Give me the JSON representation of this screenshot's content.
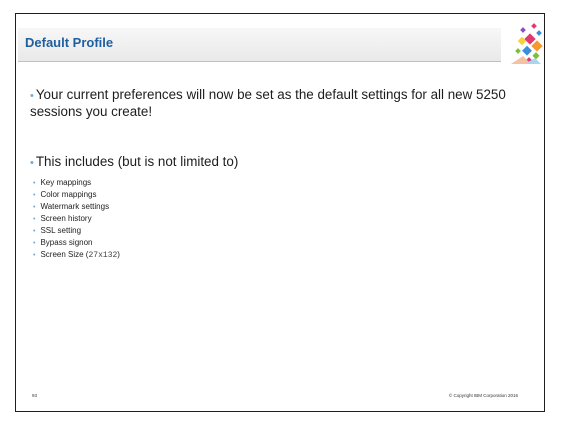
{
  "slide": {
    "title": "Default Profile",
    "bullets": [
      {
        "text": "Your current preferences will now be set as the default settings for all new 5250 sessions you create!"
      },
      {
        "text": "This includes (but is not limited to)"
      }
    ],
    "sub_items": [
      "Key mappings",
      "Color mappings",
      "Watermark settings",
      "Screen history",
      "SSL setting",
      "Bypass signon"
    ],
    "last_sub_item": {
      "text": "Screen Size (",
      "code": "27x132",
      "tail": ")"
    },
    "page_number": "93",
    "copyright": "© Copyright IBM Corporation 2016"
  },
  "colors": {
    "title": "#1f5fa0",
    "bullet": "#6aaed6",
    "logo": [
      "#e23a6e",
      "#f29a2e",
      "#7bbf3a",
      "#3a8fd8",
      "#8a4fc0",
      "#f3d23a"
    ]
  }
}
